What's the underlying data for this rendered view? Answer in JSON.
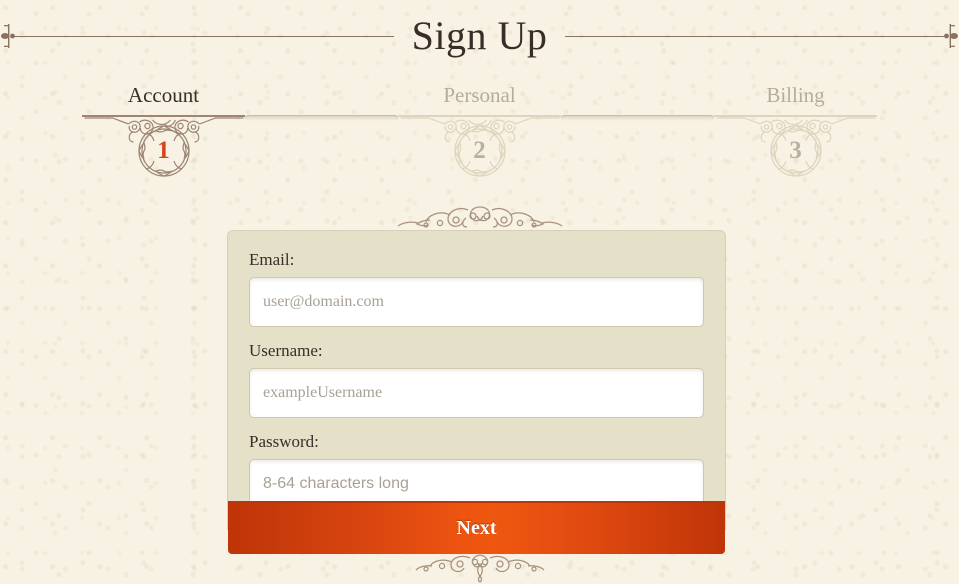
{
  "page": {
    "title": "Sign Up",
    "background_color": "#f7f2e4",
    "panel_color": "#e5e0c8",
    "accent_color": "#d4431a",
    "text_color": "#3a2d28",
    "muted_color": "#b6ac98"
  },
  "title_rule": {
    "left_cap_icon": "fleur-terminal-icon",
    "right_cap_icon": "fleur-terminal-icon"
  },
  "steps": [
    {
      "number": "1",
      "label": "Account",
      "state": "active"
    },
    {
      "number": "2",
      "label": "Personal",
      "state": "inactive"
    },
    {
      "number": "3",
      "label": "Billing",
      "state": "inactive"
    }
  ],
  "ornaments": {
    "top_flourish_icon": "scrollwork-flourish-icon",
    "bottom_flourish_icon": "scrollwork-flourish-icon"
  },
  "form": {
    "fields": [
      {
        "label": "Email:",
        "value": "",
        "placeholder": "user@domain.com",
        "type": "email"
      },
      {
        "label": "Username:",
        "value": "",
        "placeholder": "exampleUsername",
        "type": "text"
      },
      {
        "label": "Password:",
        "value": "",
        "placeholder": "8-64 characters long",
        "type": "text"
      }
    ],
    "submit_label": "Next"
  }
}
